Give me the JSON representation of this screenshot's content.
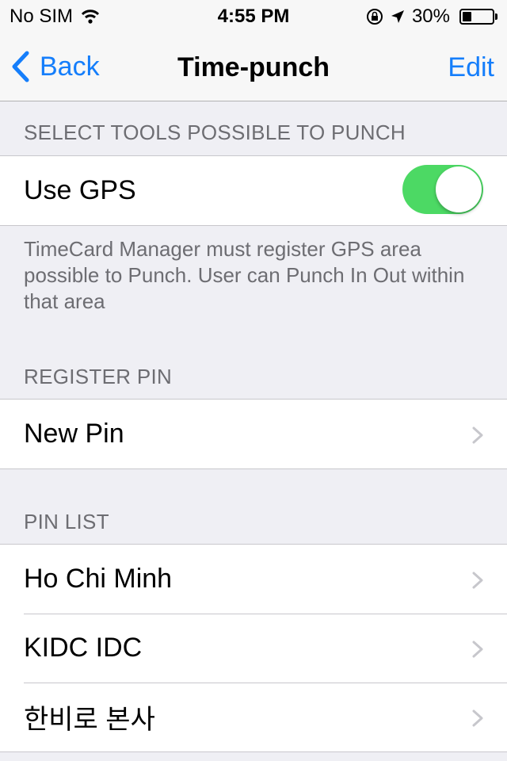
{
  "status_bar": {
    "carrier": "No SIM",
    "time": "4:55 PM",
    "battery_text": "30%",
    "battery_level": 0.3
  },
  "nav": {
    "back_label": "Back",
    "title": "Time-punch",
    "edit_label": "Edit"
  },
  "sections": {
    "select_tools": {
      "header": "SELECT TOOLS POSSIBLE TO PUNCH",
      "use_gps_label": "Use GPS",
      "use_gps_on": true,
      "footer": "TimeCard Manager must register GPS area possible to Punch. User can Punch In Out within that area"
    },
    "register_pin": {
      "header": "REGISTER PIN",
      "new_pin_label": "New Pin"
    },
    "pin_list": {
      "header": "PIN LIST",
      "items": [
        {
          "label": "Ho Chi Minh"
        },
        {
          "label": "KIDC IDC"
        },
        {
          "label": "한비로 본사"
        }
      ]
    }
  },
  "colors": {
    "accent": "#157efb",
    "toggle_on": "#4cd964",
    "background": "#efeff4",
    "header_text": "#6d6d72"
  }
}
